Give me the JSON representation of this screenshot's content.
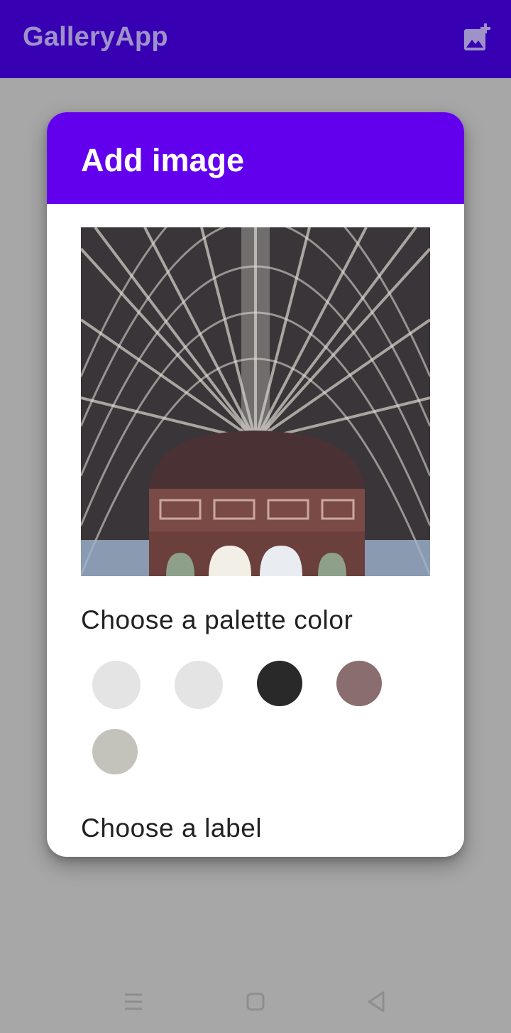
{
  "app": {
    "title": "GalleryApp",
    "toolbar_color": "#3700b3",
    "action_icon": "add-photo-icon"
  },
  "dialog": {
    "title": "Add image",
    "header_color": "#6200ee",
    "preview_subject": "station-roof-photo",
    "palette_section_title": "Choose a palette color",
    "palette_colors": [
      "#e4e4e4",
      "#e4e4e4",
      "#292929",
      "#8a6d6e",
      "#c4c3bb"
    ],
    "label_section_title": "Choose a label"
  },
  "system_nav": {
    "icons": [
      "menu-icon",
      "home-icon",
      "back-icon"
    ]
  }
}
